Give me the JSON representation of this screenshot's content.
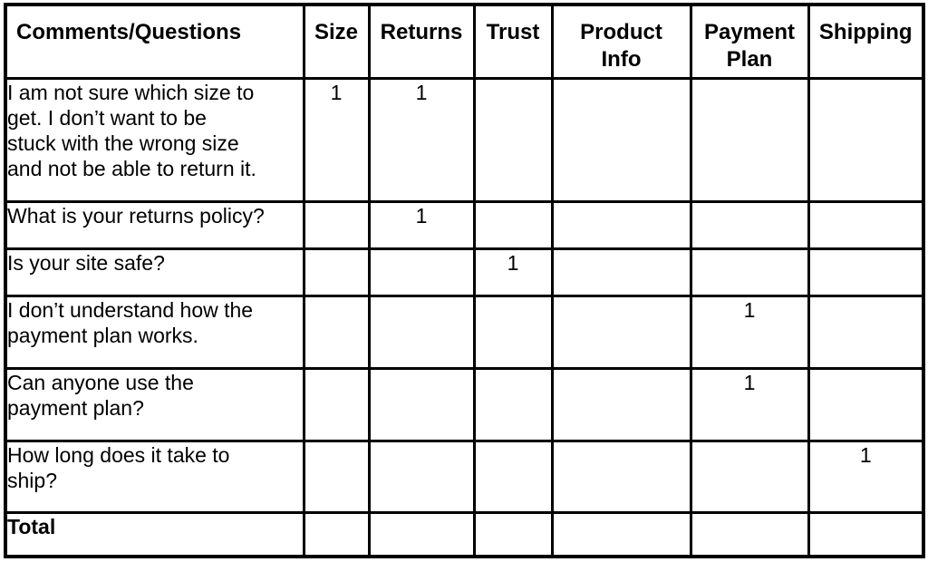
{
  "table": {
    "name": "customer-comments-tally",
    "columns": [
      {
        "key": "comments",
        "label": "Comments/Questions",
        "align": "left"
      },
      {
        "key": "size",
        "label": "Size",
        "align": "center"
      },
      {
        "key": "returns",
        "label": "Returns",
        "align": "center"
      },
      {
        "key": "trust",
        "label": "Trust",
        "align": "center"
      },
      {
        "key": "product",
        "label_line1": "Product",
        "label_line2": "Info",
        "align": "center"
      },
      {
        "key": "payment",
        "label_line1": "Payment",
        "label_line2": "Plan",
        "align": "center"
      },
      {
        "key": "shipping",
        "label": "Shipping",
        "align": "center"
      }
    ],
    "rows": [
      {
        "question_line1": "I am not sure which size to",
        "question_line2": "get. I don’t want to be",
        "question_line3": "stuck with the wrong size",
        "question_line4": "and not be able to return it.",
        "size": "1",
        "returns": "1",
        "trust": "",
        "product": "",
        "payment": "",
        "shipping": ""
      },
      {
        "question_line1": "What is your returns policy?",
        "size": "",
        "returns": "1",
        "trust": "",
        "product": "",
        "payment": "",
        "shipping": ""
      },
      {
        "question_line1": "Is your site safe?",
        "size": "",
        "returns": "",
        "trust": "1",
        "product": "",
        "payment": "",
        "shipping": ""
      },
      {
        "question_line1": "I don’t understand how the",
        "question_line2": "payment plan works.",
        "size": "",
        "returns": "",
        "trust": "",
        "product": "",
        "payment": "1",
        "shipping": ""
      },
      {
        "question_line1": "Can anyone use the",
        "question_line2": "payment plan?",
        "size": "",
        "returns": "",
        "trust": "",
        "product": "",
        "payment": "1",
        "shipping": ""
      },
      {
        "question_line1": "How long does it take to",
        "question_line2": "ship?",
        "size": "",
        "returns": "",
        "trust": "",
        "product": "",
        "payment": "",
        "shipping": "1"
      }
    ],
    "total_row": {
      "label": "Total",
      "size": "",
      "returns": "",
      "trust": "",
      "product": "",
      "payment": "",
      "shipping": ""
    }
  },
  "colors": {
    "border": "#000000",
    "text": "#000000",
    "background": "#ffffff"
  }
}
